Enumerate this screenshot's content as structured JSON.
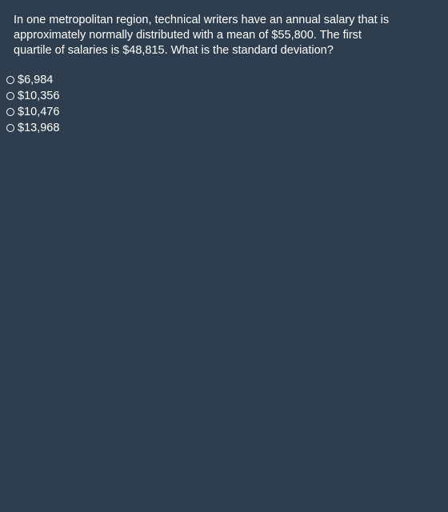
{
  "question": {
    "text": "In one metropolitan region, technical writers have an annual salary that is approximately normally distributed with a mean of $55,800. The first quartile of salaries is $48,815. What is the standard deviation?"
  },
  "options": [
    {
      "label": "$6,984",
      "selected": false
    },
    {
      "label": "$10,356",
      "selected": false
    },
    {
      "label": "$10,476",
      "selected": false
    },
    {
      "label": "$13,968",
      "selected": false
    }
  ],
  "colors": {
    "background": "#2e3e4f",
    "text": "#ffffff"
  }
}
